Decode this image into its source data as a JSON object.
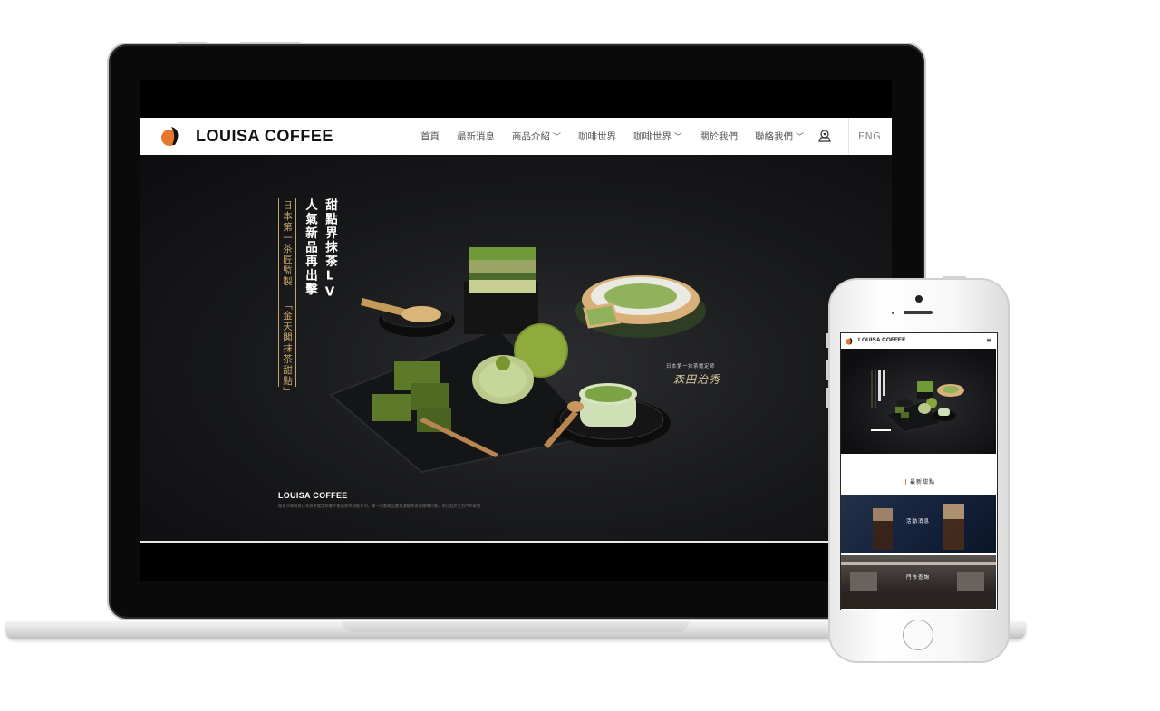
{
  "brand": {
    "name": "LOUISA COFFEE",
    "accent": "#e8772e"
  },
  "nav": {
    "items": [
      {
        "label": "首頁",
        "has_dropdown": false
      },
      {
        "label": "最新消息",
        "has_dropdown": false
      },
      {
        "label": "商品介紹",
        "has_dropdown": true
      },
      {
        "label": "咖啡世界",
        "has_dropdown": false
      },
      {
        "label": "咖啡世界",
        "has_dropdown": true
      },
      {
        "label": "關於我們",
        "has_dropdown": false
      },
      {
        "label": "聯絡我們",
        "has_dropdown": true
      }
    ],
    "user_icon": "user-location-icon",
    "language": "ENG"
  },
  "hero": {
    "headline_col1": "甜點界抹茶LV",
    "headline_col2": "人氣新品再出擊",
    "sub_col1": "日本第一茶匠監製",
    "sub_col2": "「金天閣抹茶甜點」",
    "chef_caption": "日本第一抹茶鑑定師",
    "chef_signature": "森田治秀",
    "footer_brand": "LOUISA COFFEE",
    "footer_text": "路易莎咖啡與日本抹茶鑑定師攜手推出抹茶甜點系列，每一口都能品嘗到濃郁茶香與細緻口感，即日起於全台門市販售"
  },
  "mobile": {
    "brand": "LOUISA COFFEE",
    "menu_icon": "hamburger-menu-icon",
    "section_title": "最新甜點",
    "card1_label": "活動消息",
    "card2_label": "門市查詢"
  },
  "colors": {
    "gold": "#c9a46a",
    "hero_dark": "#1a1b1d",
    "matcha": "#6f9a3a"
  }
}
